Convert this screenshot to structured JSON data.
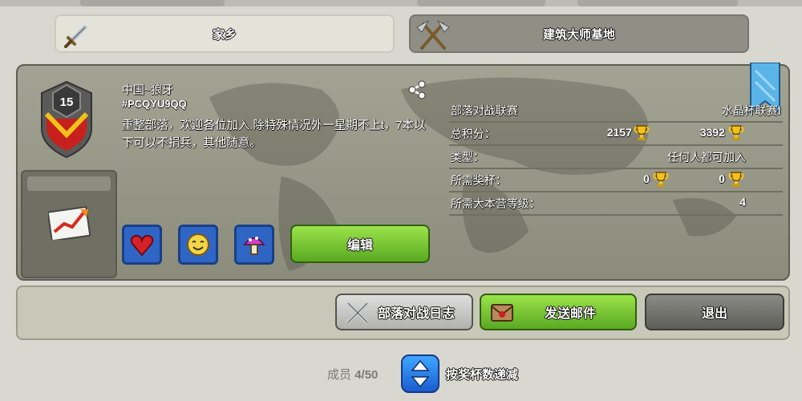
{
  "tabs": {
    "home": "家乡",
    "builder": "建筑大师基地"
  },
  "clan": {
    "level": "15",
    "name": "中国~狼牙",
    "tag": "#PCQYU9QQ",
    "description": "重整部落，欢迎各位加入.除特殊情况外一星期不上t，7本以下可以不捐兵，其他随意。"
  },
  "stats": {
    "war_league_label": "部落对战联赛",
    "war_league_value": "水晶杯联赛Ⅰ",
    "total_points_label": "总积分：",
    "total_points_home": "2157",
    "total_points_builder": "3392",
    "type_label": "类型：",
    "type_value": "任何人都可加入",
    "required_trophies_label": "所需奖杯：",
    "required_trophies_home": "0",
    "required_trophies_builder": "0",
    "required_th_label": "所需大本营等级：",
    "required_th_value": "4"
  },
  "buttons": {
    "edit": "编辑",
    "war_log": "部落对战日志",
    "send_mail": "发送邮件",
    "leave": "退出"
  },
  "members": {
    "label": "成员",
    "count": "4/50",
    "sort_label": "按奖杯数递减"
  },
  "icons": {
    "share": "share-icon",
    "trophy": "trophy-icon",
    "sort": "sort-icon"
  },
  "colors": {
    "green_button": "#5aa922",
    "blue_button": "#1a5cd0",
    "badge_red": "#c8201c"
  }
}
